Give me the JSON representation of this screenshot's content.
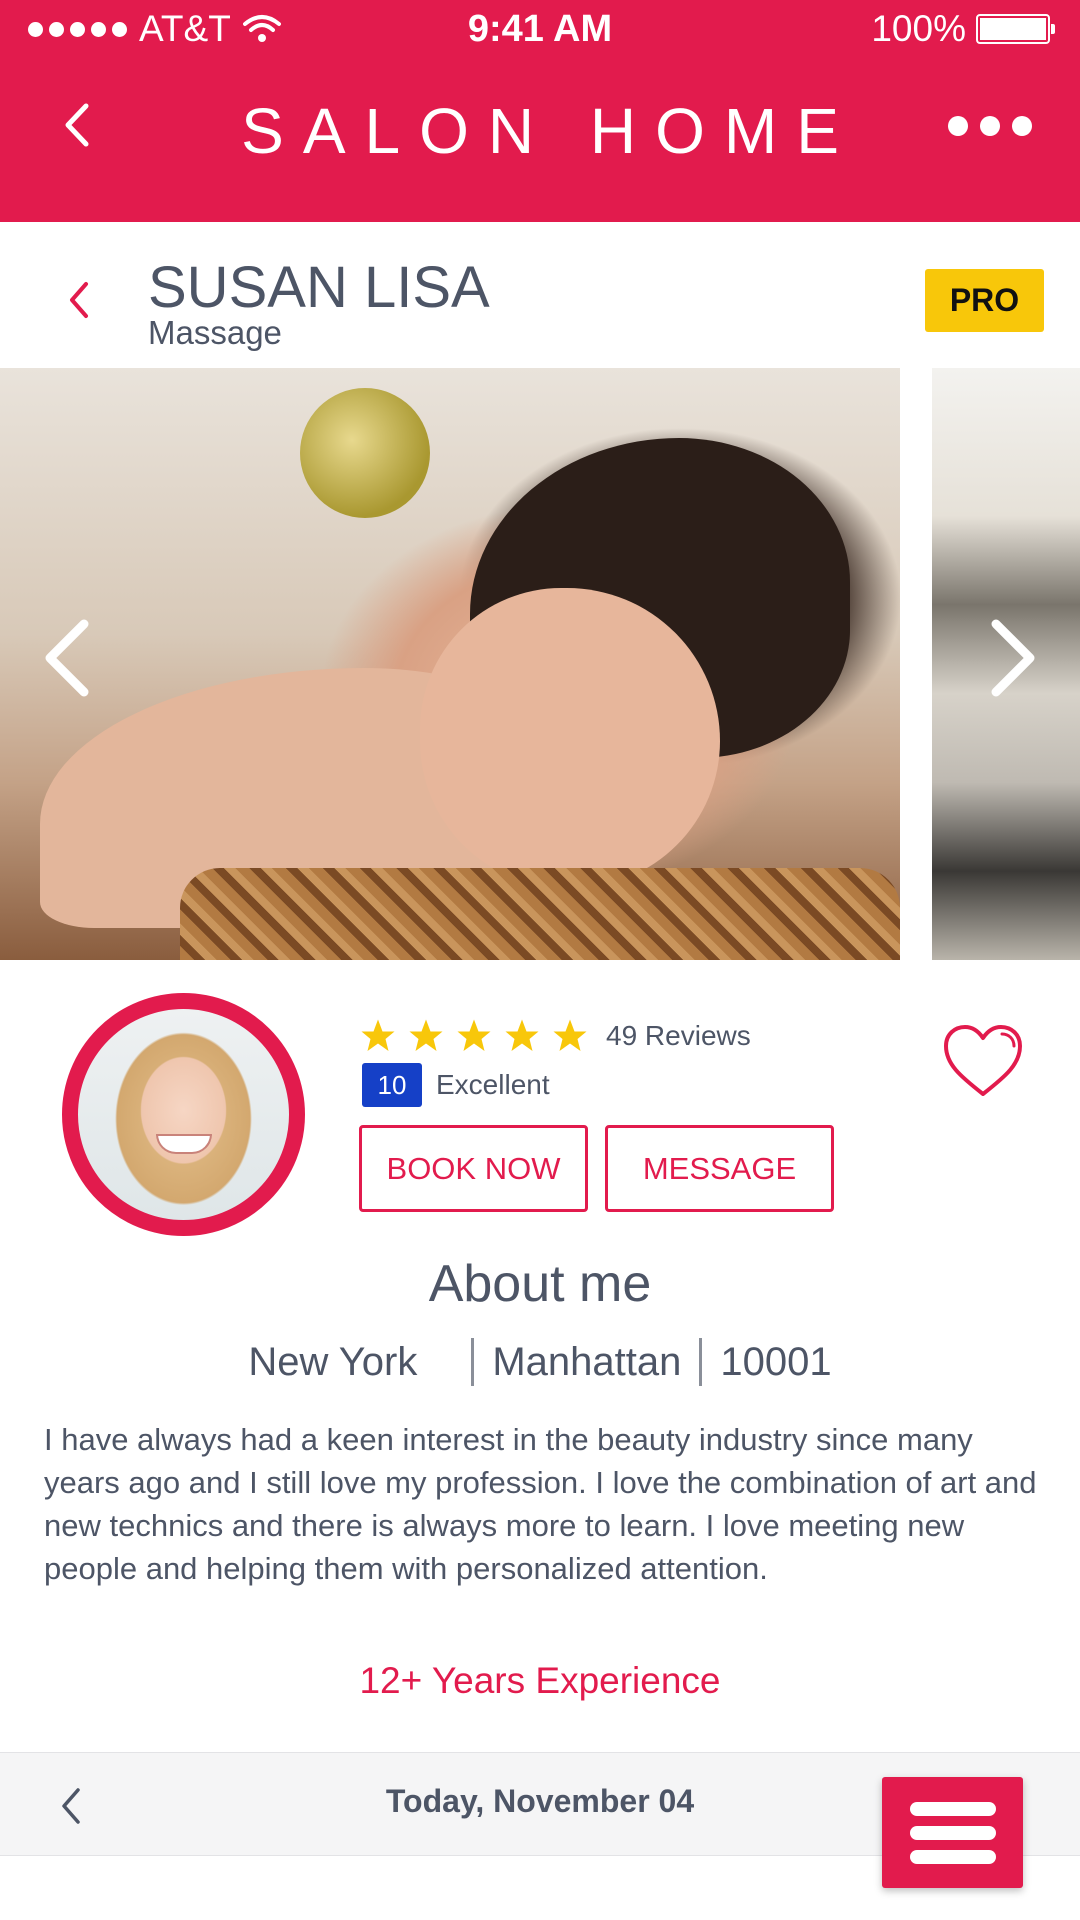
{
  "status_bar": {
    "carrier": "AT&T",
    "time": "9:41 AM",
    "battery": "100%"
  },
  "header": {
    "brand": "SALON HOME"
  },
  "profile": {
    "name": "SUSAN LISA",
    "category": "Massage",
    "badge": "PRO",
    "rating": {
      "stars": 5,
      "reviews_label": "49 Reviews",
      "score": "10",
      "score_label": "Excellent"
    },
    "actions": {
      "book_label": "BOOK NOW",
      "message_label": "MESSAGE"
    }
  },
  "gallery": {
    "images": [
      "massage-photo",
      "salon-interior-photo"
    ]
  },
  "about": {
    "title": "About me",
    "location": {
      "city": "New York",
      "area": "Manhattan",
      "zip": "10001"
    },
    "text": "I have always had a keen interest in the beauty industry since many years ago and I still love my profession. I love the combination of art and new technics and there is always more to learn. I love meeting new people and helping them with personalized attention.",
    "experience": "12+ Years Experience"
  },
  "footer": {
    "date": "Today, November 04"
  },
  "colors": {
    "brand": "#e21b4d",
    "pro_badge": "#f8c70a",
    "score_badge": "#1540c7",
    "star": "#f8c70a",
    "text": "#4d5566"
  },
  "icons": {
    "back": "chevron-left-icon",
    "more": "more-dots-icon",
    "favorite": "heart-icon",
    "menu": "hamburger-menu-icon"
  }
}
